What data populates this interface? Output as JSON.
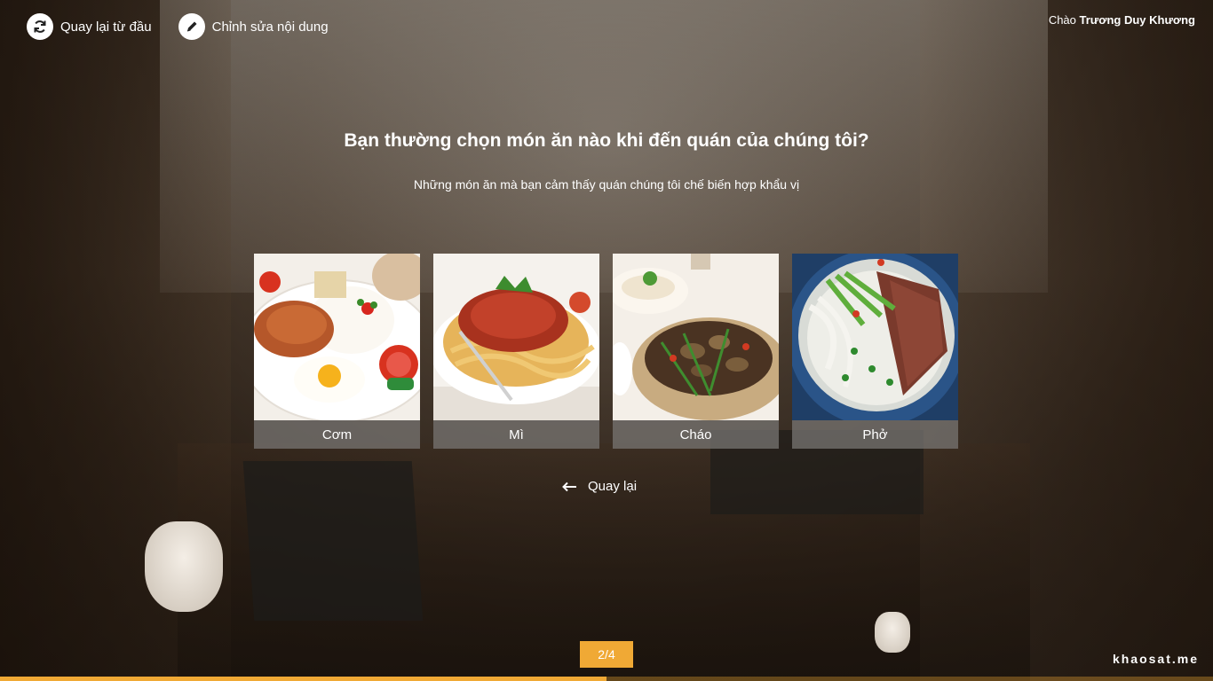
{
  "topbar": {
    "restart_label": "Quay lại từ đầu",
    "edit_label": "Chỉnh sửa nội dung",
    "greeting_prefix": "Chào",
    "user_name": "Trương Duy Khương"
  },
  "question": {
    "title": "Bạn thường chọn món ăn nào khi đến quán của chúng tôi?",
    "subtitle": "Những món ăn mà bạn cảm thấy quán chúng tôi chế biến hợp khẩu vị"
  },
  "options": [
    {
      "label": "Cơm"
    },
    {
      "label": "Mì"
    },
    {
      "label": "Cháo"
    },
    {
      "label": "Phở"
    }
  ],
  "back_label": "Quay lại",
  "page_indicator": "2/4",
  "progress": 0.5,
  "brand": "khaosat.me",
  "colors": {
    "accent": "#f0a935"
  }
}
